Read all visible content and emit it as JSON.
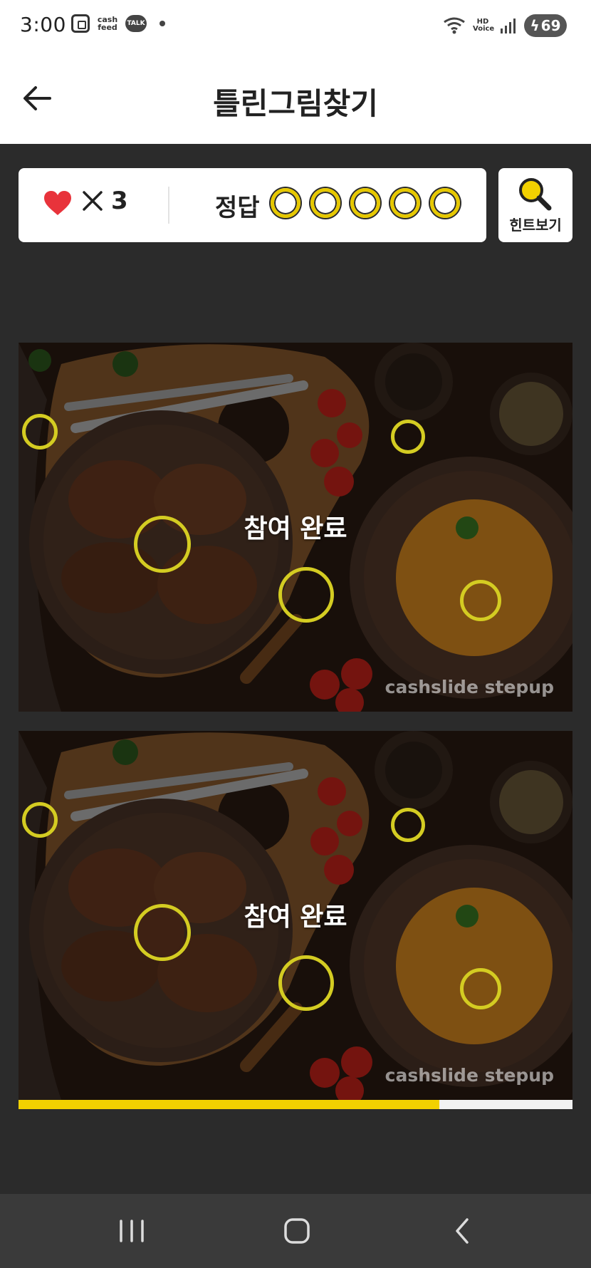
{
  "status_bar": {
    "time": "3:00",
    "app_label": "cash feed",
    "talk_label": "TALK",
    "network": "HD Voice",
    "battery": "69"
  },
  "header": {
    "title": "틀린그림찾기"
  },
  "score": {
    "lives_symbol": "✕",
    "lives": "3",
    "answer_label": "정답",
    "answer_slots": 5
  },
  "hint": {
    "label": "힌트보기"
  },
  "game": {
    "overlay_text": "참여 완료",
    "watermark": "cashslide stepup"
  },
  "progress": {
    "fraction": 0.76
  },
  "colors": {
    "accent": "#f2d100",
    "marker": "#d4cc22",
    "heart": "#e8333b",
    "background": "#2b2b2b"
  },
  "icons": {
    "back": "arrow-left-icon",
    "lives": "heart-icon",
    "hint": "magnifier-icon",
    "nav_recent": "recent-apps-icon",
    "nav_home": "home-icon",
    "nav_back": "chevron-left-icon"
  }
}
